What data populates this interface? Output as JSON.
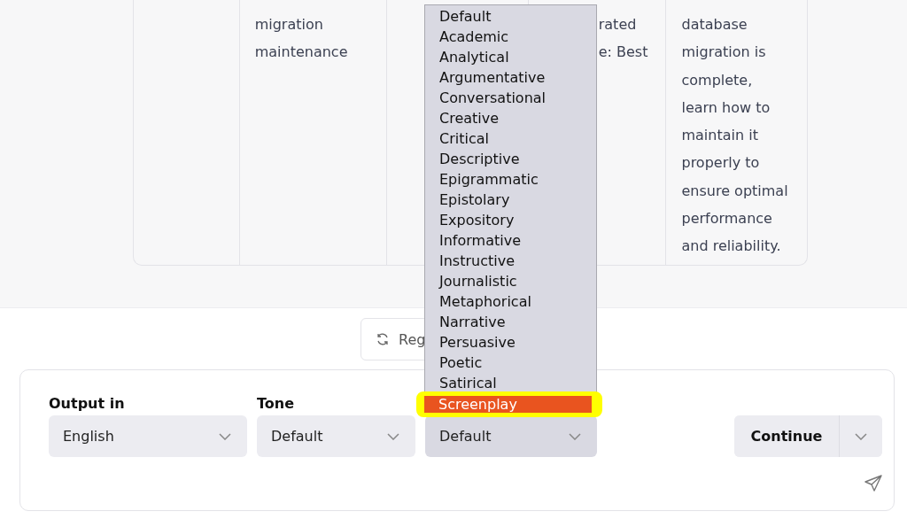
{
  "table": {
    "cells": [
      {},
      {
        "lines": [
          "migration",
          "maintenance"
        ]
      },
      {},
      {
        "lines": [
          "rated",
          "e: Best"
        ]
      },
      {
        "lines": [
          "database",
          "migration is",
          "complete,",
          "learn how to",
          "maintain it",
          "properly to",
          "ensure optimal",
          "performance",
          "and reliability."
        ]
      }
    ]
  },
  "regenerate_button": {
    "label": "Reg"
  },
  "controls": {
    "selects": [
      {
        "label": "Output in",
        "value": "English",
        "focused": false
      },
      {
        "label": "Tone",
        "value": "Default",
        "focused": false
      },
      {
        "value": "Default",
        "focused": true
      }
    ],
    "continue_button": {
      "label": "Continue"
    }
  },
  "dropdown": {
    "options": [
      {
        "label": "Default",
        "selected": false,
        "highlighted": false
      },
      {
        "label": "Academic",
        "selected": false,
        "highlighted": false
      },
      {
        "label": "Analytical",
        "selected": false,
        "highlighted": false
      },
      {
        "label": "Argumentative",
        "selected": false,
        "highlighted": false
      },
      {
        "label": "Conversational",
        "selected": false,
        "highlighted": false
      },
      {
        "label": "Creative",
        "selected": false,
        "highlighted": false
      },
      {
        "label": "Critical",
        "selected": false,
        "highlighted": false
      },
      {
        "label": "Descriptive",
        "selected": false,
        "highlighted": false
      },
      {
        "label": "Epigrammatic",
        "selected": false,
        "highlighted": false
      },
      {
        "label": "Epistolary",
        "selected": false,
        "highlighted": false
      },
      {
        "label": "Expository",
        "selected": false,
        "highlighted": false
      },
      {
        "label": "Informative",
        "selected": false,
        "highlighted": false
      },
      {
        "label": "Instructive",
        "selected": false,
        "highlighted": false
      },
      {
        "label": "Journalistic",
        "selected": false,
        "highlighted": false
      },
      {
        "label": "Metaphorical",
        "selected": false,
        "highlighted": false
      },
      {
        "label": "Narrative",
        "selected": false,
        "highlighted": false
      },
      {
        "label": "Persuasive",
        "selected": false,
        "highlighted": false
      },
      {
        "label": "Poetic",
        "selected": false,
        "highlighted": false
      },
      {
        "label": "Satirical",
        "selected": false,
        "highlighted": false
      },
      {
        "label": "Screenplay",
        "selected": true,
        "highlighted": true
      }
    ]
  }
}
